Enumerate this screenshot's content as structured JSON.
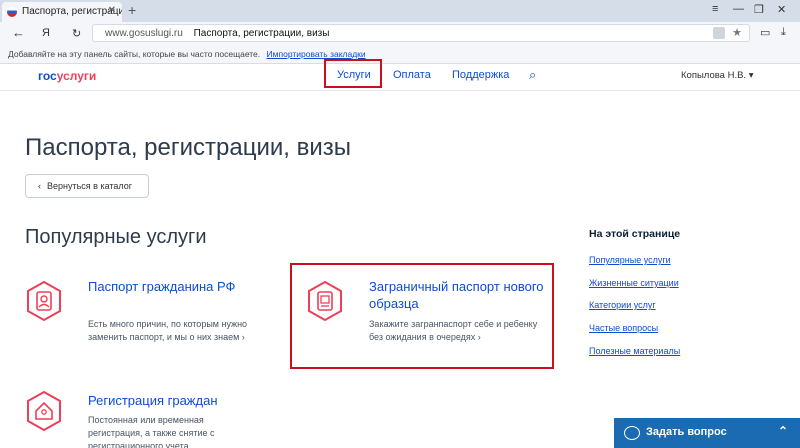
{
  "browser": {
    "tab_title": "Паспорта, регистрации, ...",
    "tab_close": "✕",
    "new_tab": "+",
    "back_icon": "←",
    "ya_icon": "Я",
    "refresh_icon": "↻",
    "address_domain": "www.gosuslugi.ru",
    "address_title": "Паспорта, регистрации, визы",
    "bookmarks_text": "Добавляйте на эту панель сайты, которые вы часто посещаете.",
    "bookmarks_link": "Импортировать закладки",
    "window_controls": [
      "≡",
      "—",
      "❐",
      "✕"
    ],
    "right_icons": [
      "▭",
      "⤓"
    ]
  },
  "header": {
    "logo_gos": "гос",
    "logo_uslugi": "услуги",
    "nav": [
      "Услуги",
      "Оплата",
      "Поддержка"
    ],
    "search_icon": "⌕",
    "user": "Копылова Н.В. ▾"
  },
  "page": {
    "title": "Паспорта, регистрации, визы",
    "back_button": "Вернуться в каталог",
    "back_chevron": "‹",
    "popular_title": "Популярные услуги",
    "services": [
      {
        "title": "Паспорт гражданина РФ",
        "desc": "Есть много причин, по которым нужно заменить паспорт, и мы о них знаем  ›"
      },
      {
        "title": "Заграничный паспорт нового образца",
        "desc": "Закажите загранпаспорт себе и ребенку без ожидания в очередях  ›"
      },
      {
        "title": "Регистрация граждан",
        "desc": "Постоянная или временная регистрация, а также снятие с регистрационного учета"
      }
    ]
  },
  "aside": {
    "title": "На этой странице",
    "links": [
      "Популярные услуги",
      "Жизненные ситуации",
      "Категории услуг",
      "Частые вопросы",
      "Полезные материалы"
    ]
  },
  "ask": {
    "label": "Задать вопрос",
    "chevron": "⌃"
  },
  "colors": {
    "accent": "#0d4cd3",
    "highlight": "#c9101e",
    "logo_red": "#ee3f58",
    "ask_bg": "#1a6bb2"
  }
}
